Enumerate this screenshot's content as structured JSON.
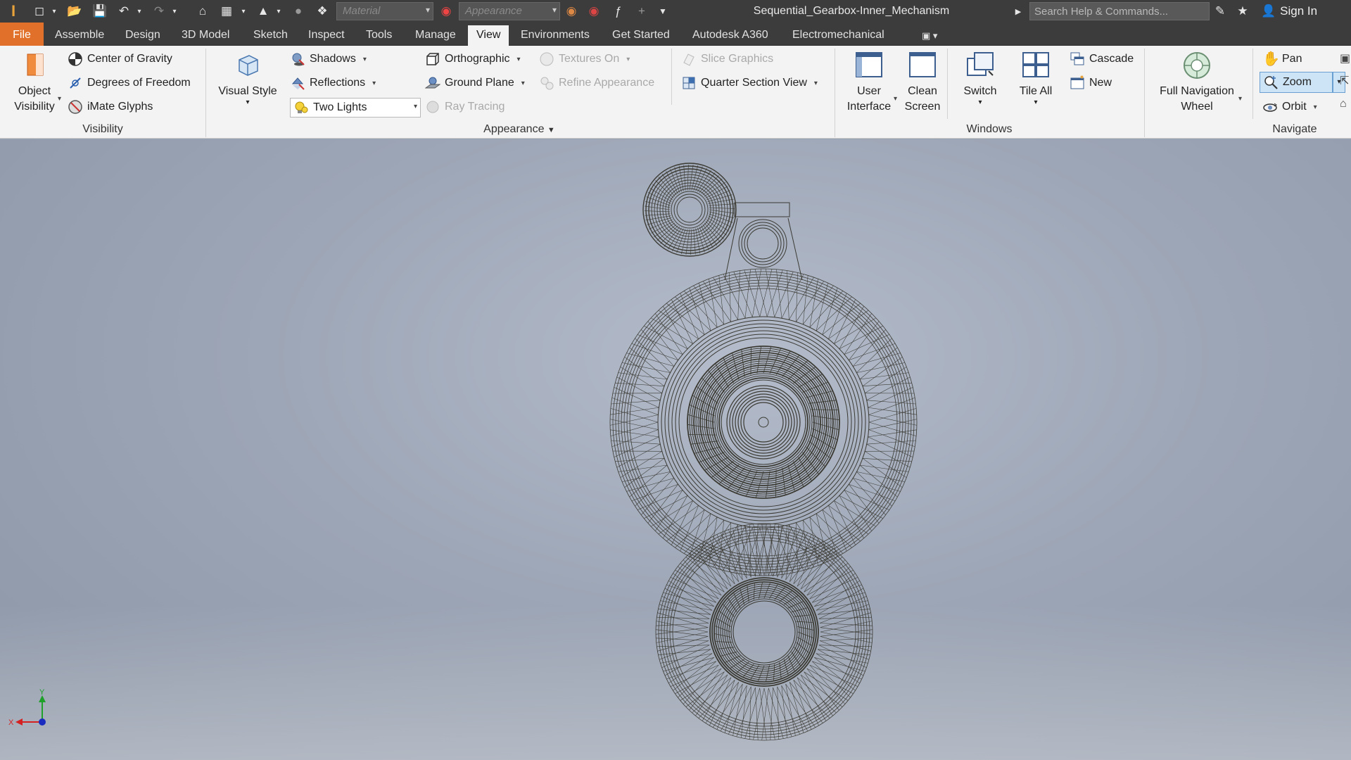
{
  "titlebar": {
    "material_placeholder": "Material",
    "appearance_placeholder": "Appearance",
    "document_title": "Sequential_Gearbox-Inner_Mechanism",
    "search_placeholder": "Search Help & Commands...",
    "signin_label": "Sign In"
  },
  "tabs": {
    "file": "File",
    "assemble": "Assemble",
    "design": "Design",
    "model3d": "3D Model",
    "sketch": "Sketch",
    "inspect": "Inspect",
    "tools": "Tools",
    "manage": "Manage",
    "view": "View",
    "environments": "Environments",
    "get_started": "Get Started",
    "a360": "Autodesk A360",
    "electromechanical": "Electromechanical"
  },
  "ribbon": {
    "visibility": {
      "title": "Visibility",
      "object_visibility_line1": "Object",
      "object_visibility_line2": "Visibility",
      "center_of_gravity": "Center of Gravity",
      "degrees_of_freedom": "Degrees of Freedom",
      "imate_glyphs": "iMate Glyphs"
    },
    "appearance": {
      "title": "Appearance",
      "visual_style": "Visual Style",
      "shadows": "Shadows",
      "reflections": "Reflections",
      "lighting_value": "Two Lights",
      "orthographic": "Orthographic",
      "ground_plane": "Ground Plane",
      "ray_tracing": "Ray Tracing",
      "textures_on": "Textures On",
      "refine_appearance": "Refine Appearance",
      "slice_graphics": "Slice Graphics",
      "quarter_section_view": "Quarter Section View"
    },
    "windows": {
      "title": "Windows",
      "user_interface_line1": "User",
      "user_interface_line2": "Interface",
      "clean_screen_line1": "Clean",
      "clean_screen_line2": "Screen",
      "switch": "Switch",
      "tile_all": "Tile All",
      "cascade": "Cascade",
      "new": "New"
    },
    "navigate": {
      "title": "Navigate",
      "full_nav_line1": "Full Navigation",
      "full_nav_line2": "Wheel",
      "pan": "Pan",
      "zoom": "Zoom",
      "orbit": "Orbit"
    }
  },
  "viewport": {
    "triad_x_label": "X",
    "triad_y_label": "Y",
    "axis_colors": {
      "x": "#d42020",
      "y": "#1ea02a",
      "z": "#1a2bbf"
    },
    "wire_color": "#3b3a33"
  },
  "colors": {
    "accent": "#e0702a",
    "titlebar_bg": "#3c3c3c",
    "ribbon_bg": "#f3f3f3",
    "zoom_active_bg": "#cde4f7"
  }
}
